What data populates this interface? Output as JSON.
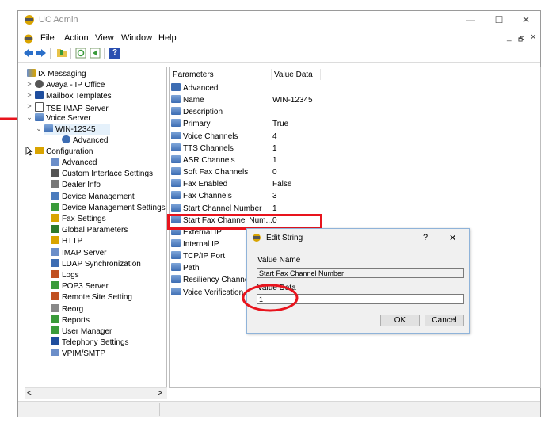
{
  "window": {
    "title": "UC Admin",
    "controls": {
      "minimize": "—",
      "maximize": "☐",
      "close": "✕"
    },
    "mdi_controls": {
      "minimize": "_",
      "restore": "🗗",
      "close": "✕"
    }
  },
  "menu": {
    "file": "File",
    "action": "Action",
    "view": "View",
    "window": "Window",
    "help": "Help"
  },
  "toolbar": {
    "icons": [
      "back-arrow-icon",
      "forward-arrow-icon",
      "folder-icon",
      "refresh-icon",
      "export-icon",
      "help-icon"
    ],
    "help_label": "?"
  },
  "tree": {
    "root": "IX Messaging",
    "avaya": "Avaya - IP Office",
    "mailbox_templates": "Mailbox Templates",
    "tse_imap": "TSE IMAP Server",
    "voice_server": "Voice Server",
    "win": "WIN-12345",
    "advanced_sub": "Advanced",
    "configuration": "Configuration",
    "config_items": [
      "Advanced",
      "Custom Interface Settings",
      "Dealer Info",
      "Device Management",
      "Device Management Settings",
      "Fax Settings",
      "Global Parameters",
      "HTTP",
      "IMAP Server",
      "LDAP Synchronization",
      "Logs",
      "POP3 Server",
      "Remote Site Setting",
      "Reorg",
      "Reports",
      "User Manager",
      "Telephony Settings",
      "VPIM/SMTP"
    ]
  },
  "list": {
    "col_parameters": "Parameters",
    "col_value": "Value Data",
    "rows": [
      {
        "name": "Advanced",
        "value": ""
      },
      {
        "name": "Name",
        "value": "WIN-12345"
      },
      {
        "name": "Description",
        "value": ""
      },
      {
        "name": "Primary",
        "value": "True"
      },
      {
        "name": "Voice Channels",
        "value": "4"
      },
      {
        "name": "TTS Channels",
        "value": "1"
      },
      {
        "name": "ASR Channels",
        "value": "1"
      },
      {
        "name": "Soft Fax Channels",
        "value": "0"
      },
      {
        "name": "Fax Enabled",
        "value": "False"
      },
      {
        "name": "Fax Channels",
        "value": "3"
      },
      {
        "name": "Start Channel Number",
        "value": "1"
      },
      {
        "name": "Start Fax Channel Num...",
        "value": "0"
      },
      {
        "name": "External IP",
        "value": ""
      },
      {
        "name": "Internal IP",
        "value": ""
      },
      {
        "name": "TCP/IP Port",
        "value": ""
      },
      {
        "name": "Path",
        "value": ""
      },
      {
        "name": "Resiliency Channel",
        "value": ""
      },
      {
        "name": "Voice Verification C",
        "value": ""
      }
    ]
  },
  "dialog": {
    "title": "Edit String",
    "help": "?",
    "close": "✕",
    "value_name_label": "Value Name",
    "value_name": "Start Fax Channel Number",
    "value_data_label": "Value Data",
    "value_data": "1",
    "ok": "OK",
    "cancel": "Cancel"
  },
  "scroll": {
    "left": "<",
    "right": ">"
  },
  "colors": {
    "highlight": "#e8141d",
    "selection": "#cce8ff"
  }
}
